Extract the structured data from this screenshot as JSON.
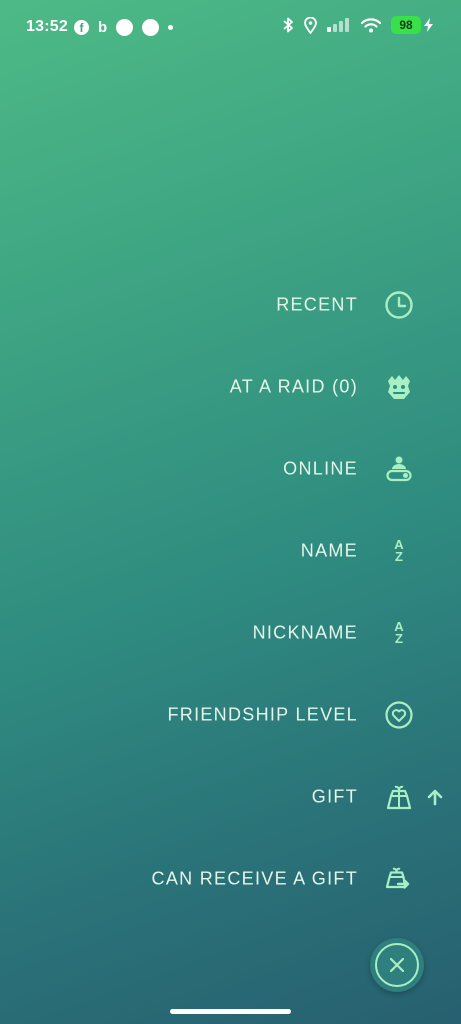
{
  "status_bar": {
    "time": "13:52",
    "facebook_glyph": "f",
    "bing_glyph": "b",
    "battery_level": "98",
    "icons": [
      "facebook-icon",
      "bing-icon",
      "notification-dot-icon",
      "notification-dot-icon",
      "small-dot-icon",
      "bluetooth-icon",
      "location-icon",
      "cellular-signal-icon",
      "wifi-icon",
      "battery-icon",
      "charging-icon"
    ]
  },
  "sort_menu": {
    "options": [
      {
        "label": "RECENT",
        "icon": "clock-icon"
      },
      {
        "label": "AT A RAID (0)",
        "icon": "raid-boss-icon"
      },
      {
        "label": "ONLINE",
        "icon": "online-toggle-icon"
      },
      {
        "label": "NAME",
        "icon": "az-sort-icon",
        "icon_text_top": "A",
        "icon_text_bottom": "Z"
      },
      {
        "label": "NICKNAME",
        "icon": "az-sort-icon",
        "icon_text_top": "A",
        "icon_text_bottom": "Z"
      },
      {
        "label": "FRIENDSHIP LEVEL",
        "icon": "heart-icon"
      },
      {
        "label": "GIFT",
        "icon": "gift-icon",
        "active_sort": "arrow-up-icon"
      },
      {
        "label": "CAN RECEIVE A GIFT",
        "icon": "gift-send-icon"
      }
    ]
  },
  "close_button": {
    "icon": "close-icon"
  },
  "colors": {
    "accent": "#a8efc3",
    "label": "#e4f6ea",
    "background_top": "#4dba86",
    "background_bottom": "#276070",
    "battery": "#38e04a"
  }
}
